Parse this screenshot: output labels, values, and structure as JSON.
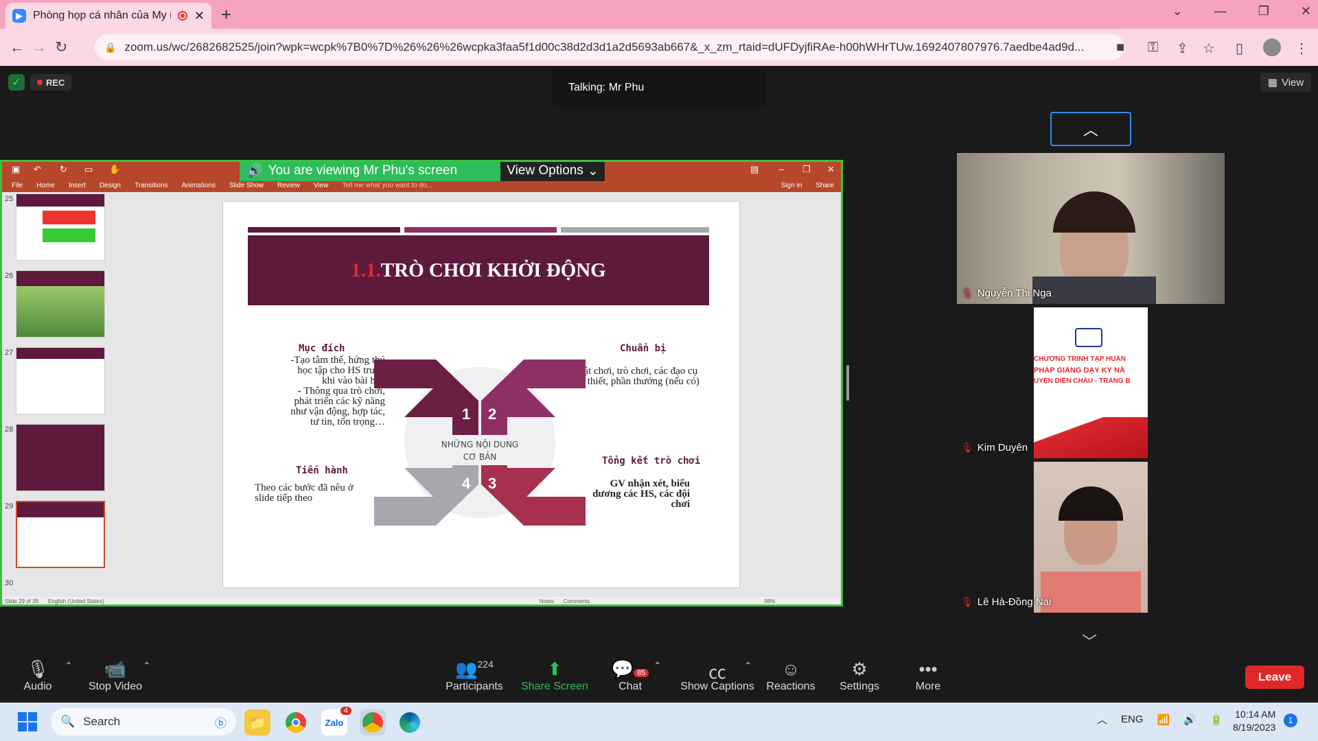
{
  "browser": {
    "tab_title": "Phòng họp cá nhân của My r",
    "url": "zoom.us/wc/2682682525/join?wpk=wcpk%7B0%7D%26%26%26wcpka3faa5f1d00c38d2d3d1a2d5693ab667&_x_zm_rtaid=dUFDyjfiRAe-h00hWHrTUw.1692407807976.7aedbe4ad9d..."
  },
  "meeting": {
    "rec_label": "REC",
    "talking": "Talking: Mr Phu",
    "view_label": "View"
  },
  "share": {
    "viewing_banner": "You are viewing Mr Phu's screen",
    "view_options": "View Options",
    "ribbon_tabs": [
      "File",
      "Home",
      "Insert",
      "Design",
      "Transitions",
      "Animations",
      "Slide Show",
      "Review",
      "View",
      "Tell me what you want to do..."
    ],
    "signin": "Sign in",
    "share_btn": "Share",
    "thumb_numbers": [
      "25",
      "26",
      "27",
      "28",
      "29",
      "30"
    ],
    "status_left": "Slide 29 of 39",
    "status_lang": "English (United States)",
    "status_notes": "Notes",
    "status_comments": "Comments",
    "zoom_pct": "98%"
  },
  "slide": {
    "title_num": "1.1.",
    "title": "TRÒ CHƠI KHỞI ĐỘNG",
    "muc_dich_head": "Mục đích",
    "muc_dich_body": [
      "-Tạo tâm thế, hứng thú",
      "học tập cho HS trước",
      "khi vào bài học",
      "- Thông qua trò chơi,",
      "phát triển các kỹ năng",
      "như vận động, hợp tác,",
      "tư tin, tốn trọng…"
    ],
    "chuan_bi_head": "Chuẩn bị",
    "chuan_bi_body": [
      "Luật chơi, trò chơi, các đạo cụ",
      "cần thiết, phần thưởng (nếu có)"
    ],
    "tien_hanh_head": "Tiến hành",
    "tien_hanh_body": [
      "Theo các bước đã nêu ở",
      "slide tiếp theo"
    ],
    "tong_ket_head": "Tổng kết trò chơi",
    "tong_ket_body": [
      "GV nhận xét, biểu",
      "dương các HS, các đội",
      "chơi"
    ],
    "center_text": [
      "NHỮNG NỘI DUNG",
      "CƠ BẢN"
    ],
    "quadrants": [
      "1",
      "2",
      "3",
      "4"
    ]
  },
  "participants": [
    {
      "name": "Nguyễn Thị Nga"
    },
    {
      "name": "Kim Duyên",
      "shared_lines": [
        "CHƯƠNG TRÌNH TẬP HUẤN",
        "PHÁP GIẢNG DẠY KỸ NĂ",
        "UYỆN DIỄN CHÂU - TRÀNG B"
      ]
    },
    {
      "name": "Lê Hà-Đồng Nai"
    }
  ],
  "toolbar": {
    "audio": "Audio",
    "stop_video": "Stop Video",
    "participants": "Participants",
    "participants_count": "224",
    "share_screen": "Share Screen",
    "chat": "Chat",
    "chat_badge": "85",
    "show_captions": "Show Captions",
    "reactions": "Reactions",
    "settings": "Settings",
    "more": "More",
    "leave": "Leave"
  },
  "taskbar": {
    "search": "Search",
    "zalo_badge": "4",
    "lang": "ENG",
    "time": "10:14 AM",
    "date": "8/19/2023",
    "notif": "1"
  },
  "colors": {
    "slide_maroon": "#5e1a3c",
    "accent_green": "#2ebd5a",
    "leave_red": "#e02828",
    "zoom_blue": "#2d8cff"
  }
}
